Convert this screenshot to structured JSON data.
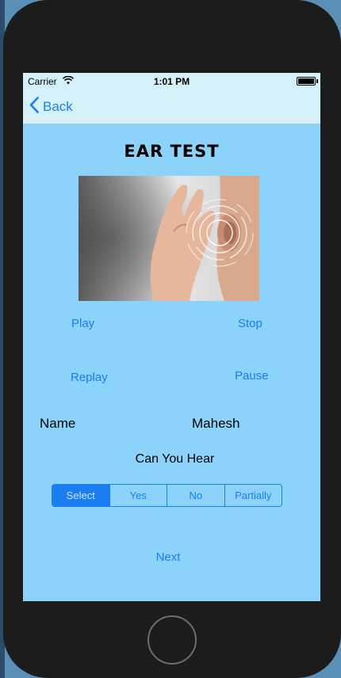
{
  "status_bar": {
    "carrier": "Carrier",
    "time": "1:01 PM"
  },
  "nav": {
    "back_label": "Back"
  },
  "page": {
    "title": "EAR TEST"
  },
  "controls": {
    "play": "Play",
    "stop": "Stop",
    "replay": "Replay",
    "pause": "Pause"
  },
  "name_row": {
    "label": "Name",
    "value": "Mahesh"
  },
  "question": "Can You Hear",
  "segment": {
    "options": [
      "Select",
      "Yes",
      "No",
      "Partially"
    ],
    "selected": "Select"
  },
  "next_label": "Next",
  "colors": {
    "accent": "#1a7ef0",
    "screen_bg": "#8cd3fb",
    "navbar_bg": "#d4f1f9"
  }
}
